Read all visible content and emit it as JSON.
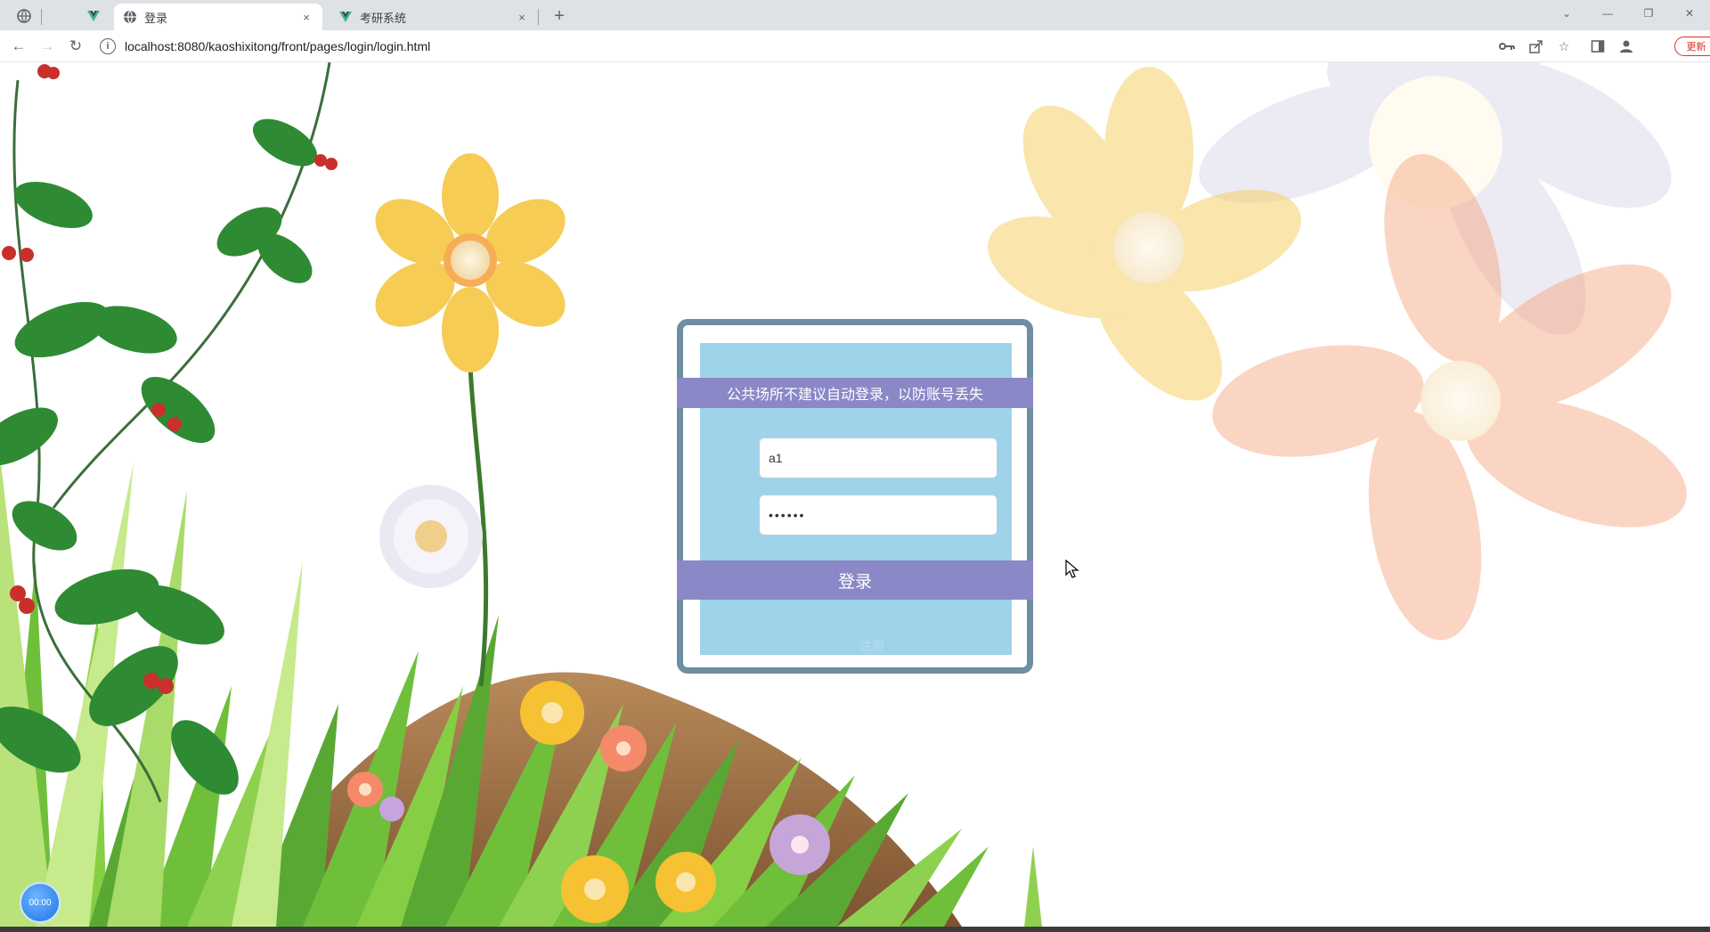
{
  "browser": {
    "tabs": [
      {
        "title": "登录",
        "icon": "globe-icon",
        "active": true
      },
      {
        "title": "考研系统",
        "icon": "vue-icon",
        "active": false
      }
    ],
    "new_tab_label": "+",
    "close_glyph": "×",
    "url": "localhost:8080/kaoshixitong/front/pages/login/login.html",
    "update_label": "更新"
  },
  "login": {
    "notice": "公共场所不建议自动登录，以防账号丢失",
    "username_value": "a1",
    "password_value": "••••••",
    "submit_label": "登录",
    "register_label": "注册"
  },
  "overlay": {
    "avatar_text": "00:00"
  },
  "colors": {
    "accent": "#8a88c6",
    "panel": "#9fd3ea",
    "frame": "#6e8ea4"
  }
}
